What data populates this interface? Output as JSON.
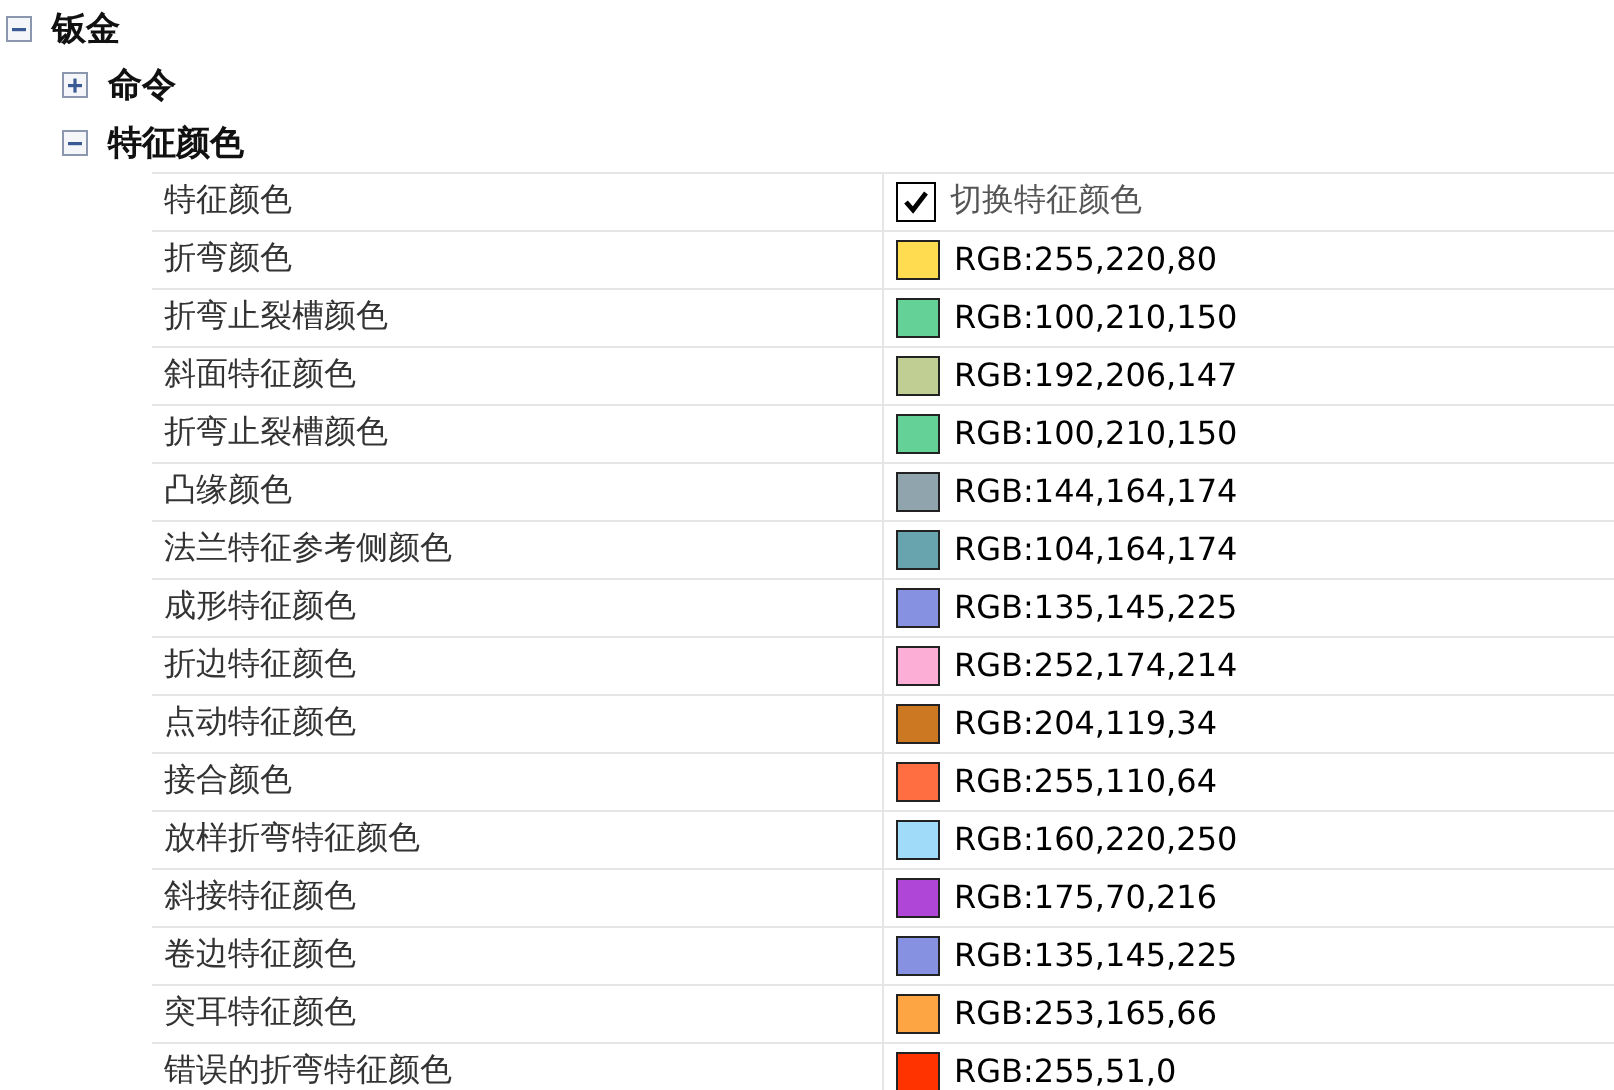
{
  "tree": [
    {
      "label": "钣金",
      "expanded": true,
      "children": [
        {
          "label": "命令",
          "expanded": false
        },
        {
          "label": "特征颜色",
          "expanded": true,
          "properties": [
            {
              "name": "特征颜色",
              "kind": "checkbox",
              "checked": true,
              "value": "切换特征颜色"
            },
            {
              "name": "折弯颜色",
              "kind": "color",
              "color": "#ffdc50",
              "value": "RGB:255,220,80"
            },
            {
              "name": "折弯止裂槽颜色",
              "kind": "color",
              "color": "#64d296",
              "value": "RGB:100,210,150"
            },
            {
              "name": "斜面特征颜色",
              "kind": "color",
              "color": "#c0ce93",
              "value": "RGB:192,206,147"
            },
            {
              "name": "折弯止裂槽颜色",
              "kind": "color",
              "color": "#64d296",
              "value": "RGB:100,210,150"
            },
            {
              "name": "凸缘颜色",
              "kind": "color",
              "color": "#90a4ae",
              "value": "RGB:144,164,174"
            },
            {
              "name": "法兰特征参考侧颜色",
              "kind": "color",
              "color": "#68a4ae",
              "value": "RGB:104,164,174"
            },
            {
              "name": "成形特征颜色",
              "kind": "color",
              "color": "#8791e1",
              "value": "RGB:135,145,225"
            },
            {
              "name": "折边特征颜色",
              "kind": "color",
              "color": "#fcaed6",
              "value": "RGB:252,174,214"
            },
            {
              "name": "点动特征颜色",
              "kind": "color",
              "color": "#cc7722",
              "value": "RGB:204,119,34"
            },
            {
              "name": "接合颜色",
              "kind": "color",
              "color": "#ff6e40",
              "value": "RGB:255,110,64"
            },
            {
              "name": "放样折弯特征颜色",
              "kind": "color",
              "color": "#a0dcfa",
              "value": "RGB:160,220,250"
            },
            {
              "name": "斜接特征颜色",
              "kind": "color",
              "color": "#af46d8",
              "value": "RGB:175,70,216"
            },
            {
              "name": "卷边特征颜色",
              "kind": "color",
              "color": "#8791e1",
              "value": "RGB:135,145,225"
            },
            {
              "name": "突耳特征颜色",
              "kind": "color",
              "color": "#fda542",
              "value": "RGB:253,165,66"
            },
            {
              "name": "错误的折弯特征颜色",
              "kind": "color",
              "color": "#ff3300",
              "value": "RGB:255,51,0"
            }
          ]
        }
      ]
    }
  ]
}
